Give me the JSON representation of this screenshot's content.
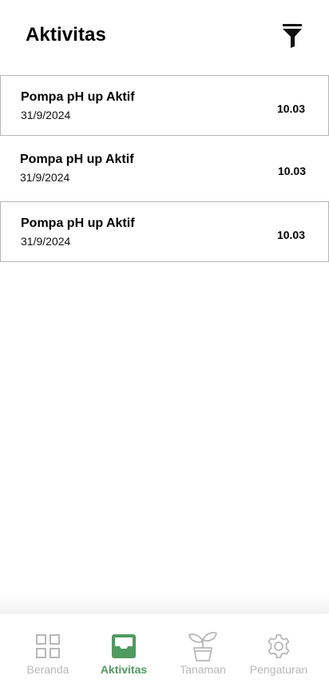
{
  "header": {
    "title": "Aktivitas",
    "filter_icon": "filter-icon"
  },
  "activities": [
    {
      "title": "Pompa pH up Aktif",
      "date": "31/9/2024",
      "time": "10.03"
    },
    {
      "title": "Pompa pH up Aktif",
      "date": "31/9/2024",
      "time": "10.03"
    },
    {
      "title": "Pompa pH up Aktif",
      "date": "31/9/2024",
      "time": "10.03"
    }
  ],
  "nav": {
    "items": [
      {
        "label": "Beranda",
        "icon": "grid-icon",
        "active": false
      },
      {
        "label": "Aktivitas",
        "icon": "inbox-icon",
        "active": true
      },
      {
        "label": "Tanaman",
        "icon": "plant-icon",
        "active": false
      },
      {
        "label": "Pengaturan",
        "icon": "gear-icon",
        "active": false
      }
    ]
  },
  "colors": {
    "accent": "#4f9a5f",
    "inactive": "#b8b8b8",
    "card_border": "#b5b5b5"
  }
}
